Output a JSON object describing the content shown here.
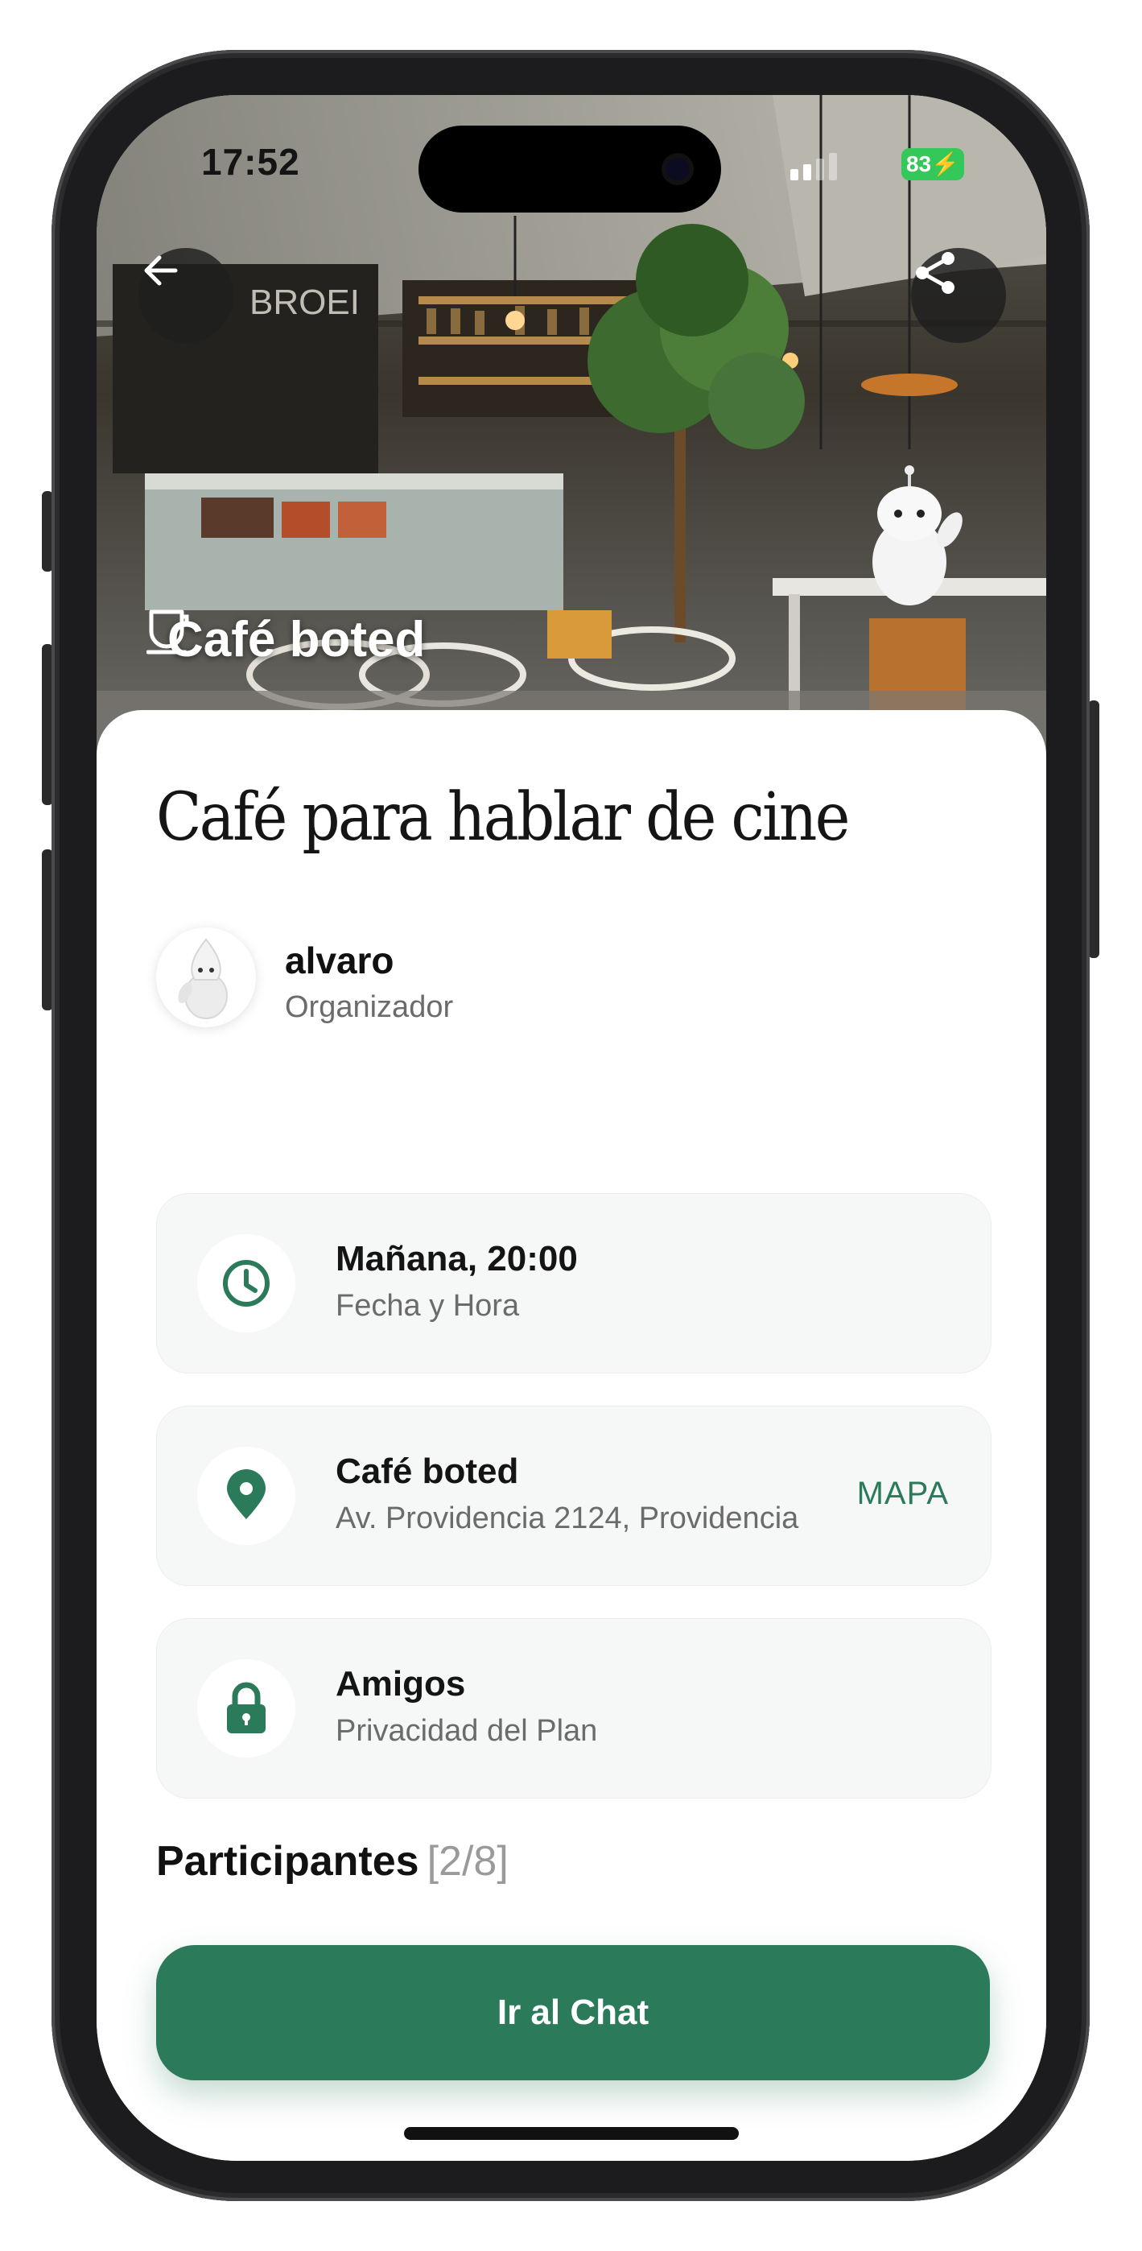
{
  "status_bar": {
    "time": "17:52",
    "battery": "83"
  },
  "hero": {
    "venue_icon": "coffee-cup-icon",
    "venue_name": "Café boted",
    "back_icon": "arrow-left-icon",
    "share_icon": "share-icon",
    "photo_sign": "BROEI"
  },
  "plan": {
    "title": "Café para hablar de cine",
    "organizer": {
      "name": "alvaro",
      "role": "Organizador"
    },
    "details": [
      {
        "icon": "clock-icon",
        "title": "Mañana, 20:00",
        "subtitle": "Fecha y Hora"
      },
      {
        "icon": "location-pin-icon",
        "title": "Café boted",
        "subtitle": "Av. Providencia 2124, Providencia",
        "action": "MAPA"
      },
      {
        "icon": "lock-icon",
        "title": "Amigos",
        "subtitle": "Privacidad del Plan"
      }
    ],
    "participants": {
      "label": "Participantes",
      "count": "[2/8]"
    },
    "chat_button": "Ir al Chat"
  },
  "colors": {
    "brand_green": "#2b7a5a",
    "card_background": "#f6f8f7",
    "battery_green": "#34c759"
  }
}
